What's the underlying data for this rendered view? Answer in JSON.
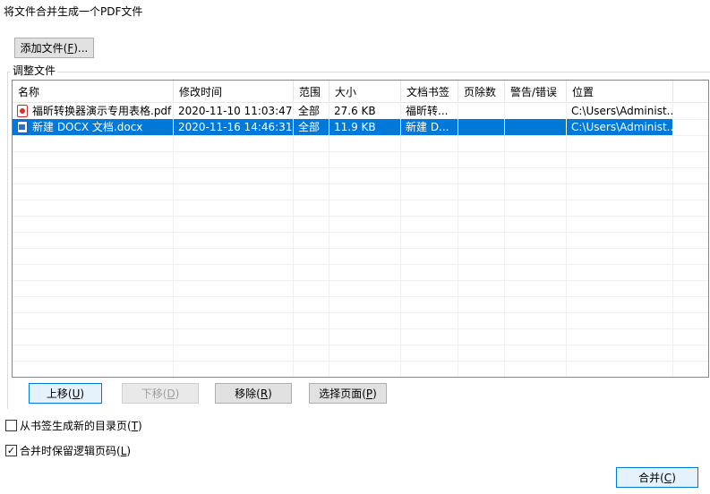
{
  "dialog": {
    "instruction": "将文件合并生成一个PDF文件",
    "add_files_button": {
      "text": "添加文件(",
      "key": "F",
      "suffix": ")..."
    },
    "group_title": "调整文件"
  },
  "table": {
    "columns": [
      "名称",
      "修改时间",
      "范围",
      "大小",
      "文档书签",
      "页除数",
      "警告/错误",
      "位置"
    ],
    "rows": [
      {
        "name": "福昕转换器演示专用表格.pdf",
        "modified": "2020-11-10 11:03:47",
        "range": "全部",
        "size": "27.6 KB",
        "bookmark": "福昕转...",
        "pages": "",
        "warnings": "",
        "location": "C:\\Users\\Administ...",
        "icon": "pdf-file-icon",
        "selected": false
      },
      {
        "name": "新建 DOCX 文档.docx",
        "modified": "2020-11-16 14:46:31",
        "range": "全部",
        "size": "11.9 KB",
        "bookmark": "新建 D...",
        "pages": "",
        "warnings": "",
        "location": "C:\\Users\\Administ...",
        "icon": "docx-file-icon",
        "selected": true
      }
    ]
  },
  "actions": {
    "move_up": {
      "text": "上移(",
      "key": "U",
      "suffix": ")"
    },
    "move_down": {
      "text": "下移(",
      "key": "D",
      "suffix": ")"
    },
    "remove": {
      "text": "移除(",
      "key": "R",
      "suffix": ")"
    },
    "select_pages": {
      "text": "选择页面(",
      "key": "P",
      "suffix": ")"
    }
  },
  "options": {
    "generate_toc": {
      "text": "从书签生成新的目录页(",
      "key": "T",
      "suffix": ")",
      "checked": false
    },
    "keep_logical_page_numbers": {
      "text": "合并时保留逻辑页码(",
      "key": "L",
      "suffix": ")",
      "checked": true
    }
  },
  "footer": {
    "merge_button": {
      "text": "合并(",
      "key": "C",
      "suffix": ")"
    }
  }
}
